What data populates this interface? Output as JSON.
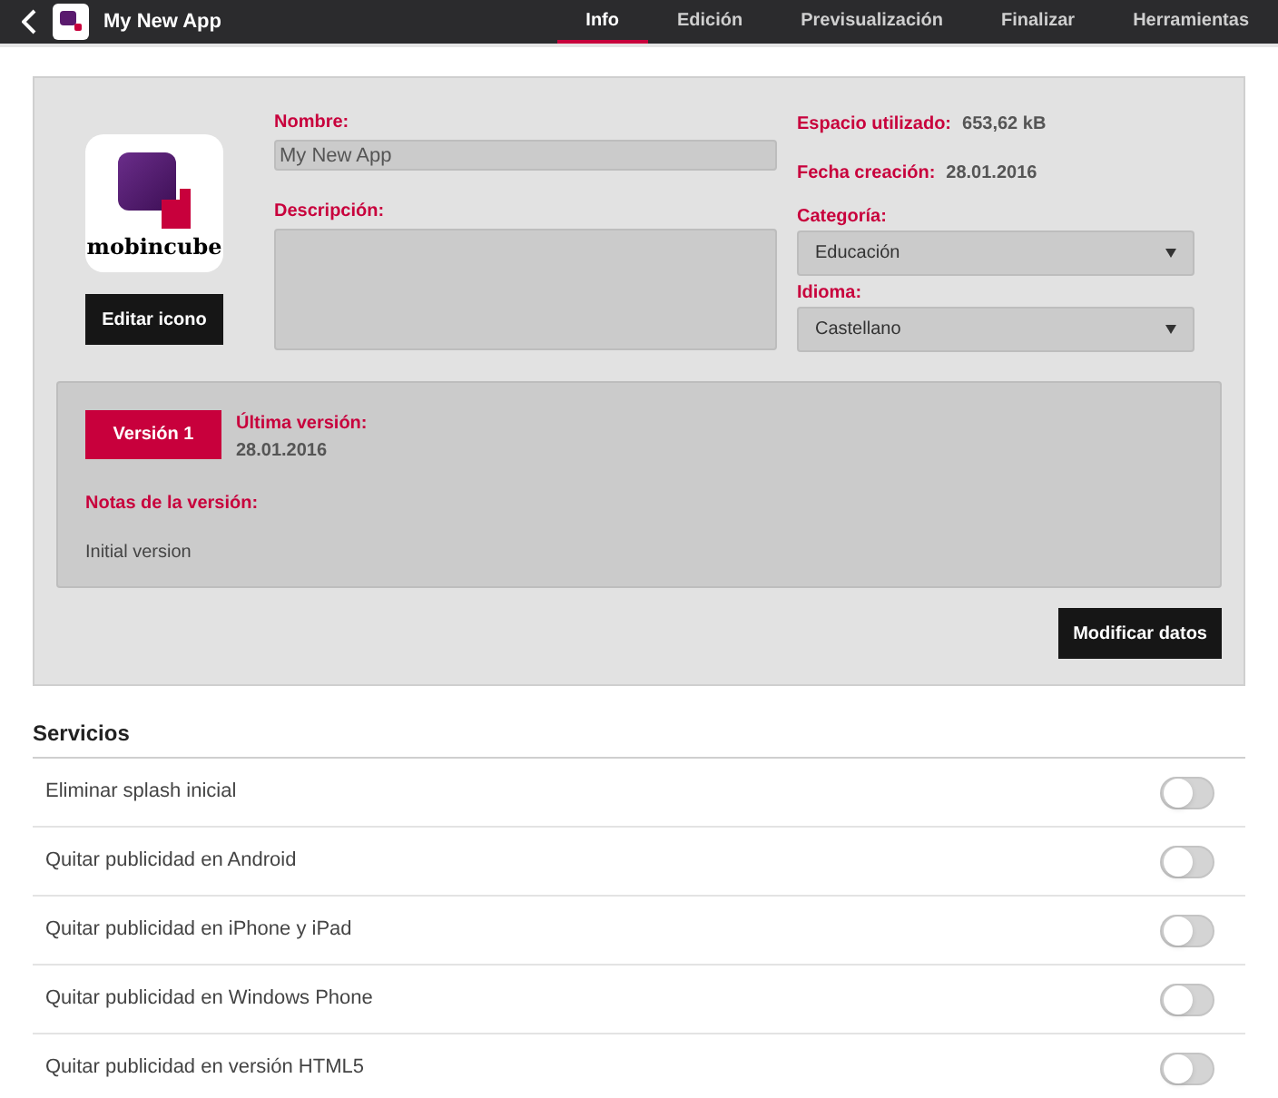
{
  "header": {
    "app_title": "My New App",
    "tabs": [
      {
        "label": "Info",
        "selected": true
      },
      {
        "label": "Edición",
        "selected": false
      },
      {
        "label": "Previsualización",
        "selected": false
      },
      {
        "label": "Finalizar",
        "selected": false
      },
      {
        "label": "Herramientas",
        "selected": false
      }
    ]
  },
  "info": {
    "logo_text": "mobincube",
    "edit_icon_button": "Editar icono",
    "name_label": "Nombre:",
    "name_value": "My New App",
    "description_label": "Descripción:",
    "space_label": "Espacio utilizado:",
    "space_value": "653,62 kB",
    "created_label": "Fecha creación:",
    "created_value": "28.01.2016",
    "category_label": "Categoría:",
    "category_value": "Educación",
    "language_label": "Idioma:",
    "language_value": "Castellano",
    "version": {
      "badge": "Versión 1",
      "latest_label": "Última versión:",
      "latest_value": "28.01.2016",
      "notes_label": "Notas de la versión:",
      "notes_value": "Initial version"
    },
    "modify_button": "Modificar datos"
  },
  "services": {
    "title": "Servicios",
    "items": [
      {
        "label": "Eliminar splash inicial",
        "on": false
      },
      {
        "label": "Quitar publicidad en Android",
        "on": false
      },
      {
        "label": "Quitar publicidad en iPhone y iPad",
        "on": false
      },
      {
        "label": "Quitar publicidad en Windows Phone",
        "on": false
      },
      {
        "label": "Quitar publicidad en versión HTML5",
        "on": false
      }
    ]
  }
}
